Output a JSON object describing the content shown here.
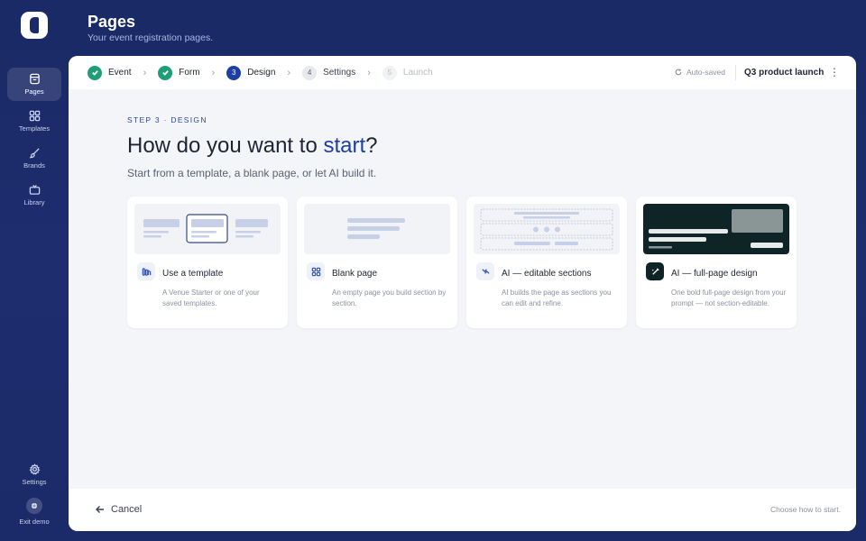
{
  "app": {
    "title": "Pages",
    "subtitle": "Your event registration pages."
  },
  "sidebar": {
    "items": [
      {
        "label": "Pages",
        "icon": "pages-icon",
        "active": true
      },
      {
        "label": "Templates",
        "icon": "grid-icon"
      },
      {
        "label": "Brands",
        "icon": "brush-icon"
      },
      {
        "label": "Library",
        "icon": "tv-icon"
      }
    ],
    "bottom": [
      {
        "label": "Settings",
        "icon": "gear-icon"
      },
      {
        "label": "Exit demo",
        "icon": "exit-icon"
      }
    ]
  },
  "steps": [
    {
      "number": "",
      "label": "Event",
      "state": "done"
    },
    {
      "number": "",
      "label": "Form",
      "state": "done"
    },
    {
      "number": "3",
      "label": "Design",
      "state": "current"
    },
    {
      "number": "4",
      "label": "Settings",
      "state": "todo"
    },
    {
      "number": "5",
      "label": "Launch",
      "state": "future"
    }
  ],
  "toolbar": {
    "autosave": "Auto-saved",
    "project": "Q3 product launch"
  },
  "main": {
    "eyebrow": "STEP 3 · DESIGN",
    "heading_pre": "How do you want to ",
    "heading_accent": "start",
    "heading_post": "?",
    "subheading": "Start from a template, a blank page, or let AI build it."
  },
  "cards": [
    {
      "title": "Use a template",
      "description": "A Venue Starter or one of your saved templates.",
      "icon": "template-icon"
    },
    {
      "title": "Blank page",
      "description": "An empty page you build section by section.",
      "icon": "grid-icon"
    },
    {
      "title": "AI — editable sections",
      "description": "AI builds the page as sections you can edit and refine.",
      "icon": "sparkle-icon"
    },
    {
      "title": "AI — full-page design",
      "description": "One bold full-page design from your prompt — not section-editable.",
      "icon": "wand-icon"
    }
  ],
  "footer": {
    "cancel": "Cancel",
    "hint": "Choose how to start."
  },
  "colors": {
    "accent": "#1c3fa6",
    "done": "#1f9d74",
    "sidebar_bg": "#1b2a68",
    "ai_dark": "#0f2426"
  }
}
